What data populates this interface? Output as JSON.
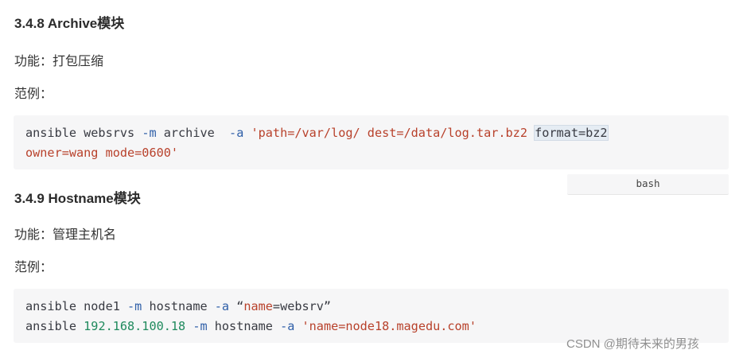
{
  "sections": [
    {
      "heading": "3.4.8 Archive模块",
      "function_text": "功能：打包压缩",
      "example_label": "范例：",
      "code_lines": [
        [
          {
            "t": "plain",
            "v": "ansible websrvs "
          },
          {
            "t": "kw",
            "v": "-m"
          },
          {
            "t": "plain",
            "v": " archive  "
          },
          {
            "t": "kw",
            "v": "-a"
          },
          {
            "t": "plain",
            "v": " "
          },
          {
            "t": "str",
            "v": "'path=/var/log/ dest=/data/log.tar.bz2 "
          },
          {
            "t": "hl",
            "v": "format=bz2"
          }
        ],
        [
          {
            "t": "str",
            "v": "owner=wang mode=0600'"
          }
        ]
      ]
    },
    {
      "heading": "3.4.9 Hostname模块",
      "function_text": "功能：管理主机名",
      "example_label": "范例：",
      "code_lines": [
        [
          {
            "t": "plain",
            "v": "ansible node1 "
          },
          {
            "t": "kw",
            "v": "-m"
          },
          {
            "t": "plain",
            "v": " hostname "
          },
          {
            "t": "kw",
            "v": "-a"
          },
          {
            "t": "plain",
            "v": " “"
          },
          {
            "t": "str",
            "v": "name"
          },
          {
            "t": "plain",
            "v": "=websrv”"
          }
        ],
        [
          {
            "t": "plain",
            "v": "ansible "
          },
          {
            "t": "num",
            "v": "192.168.100.18"
          },
          {
            "t": "plain",
            "v": " "
          },
          {
            "t": "kw",
            "v": "-m"
          },
          {
            "t": "plain",
            "v": " hostname "
          },
          {
            "t": "kw",
            "v": "-a"
          },
          {
            "t": "plain",
            "v": " "
          },
          {
            "t": "str",
            "v": "'name=node18.magedu.com'"
          }
        ]
      ]
    }
  ],
  "code_language_badge": "bash",
  "watermark": "CSDN @期待未来的男孩",
  "colors": {
    "code_background": "#f6f6f7",
    "keyword": "#2f5fa8",
    "string": "#b8412b",
    "number": "#1f8a5d",
    "highlight": "#e5ecf3",
    "watermark": "#8f8f8f"
  }
}
